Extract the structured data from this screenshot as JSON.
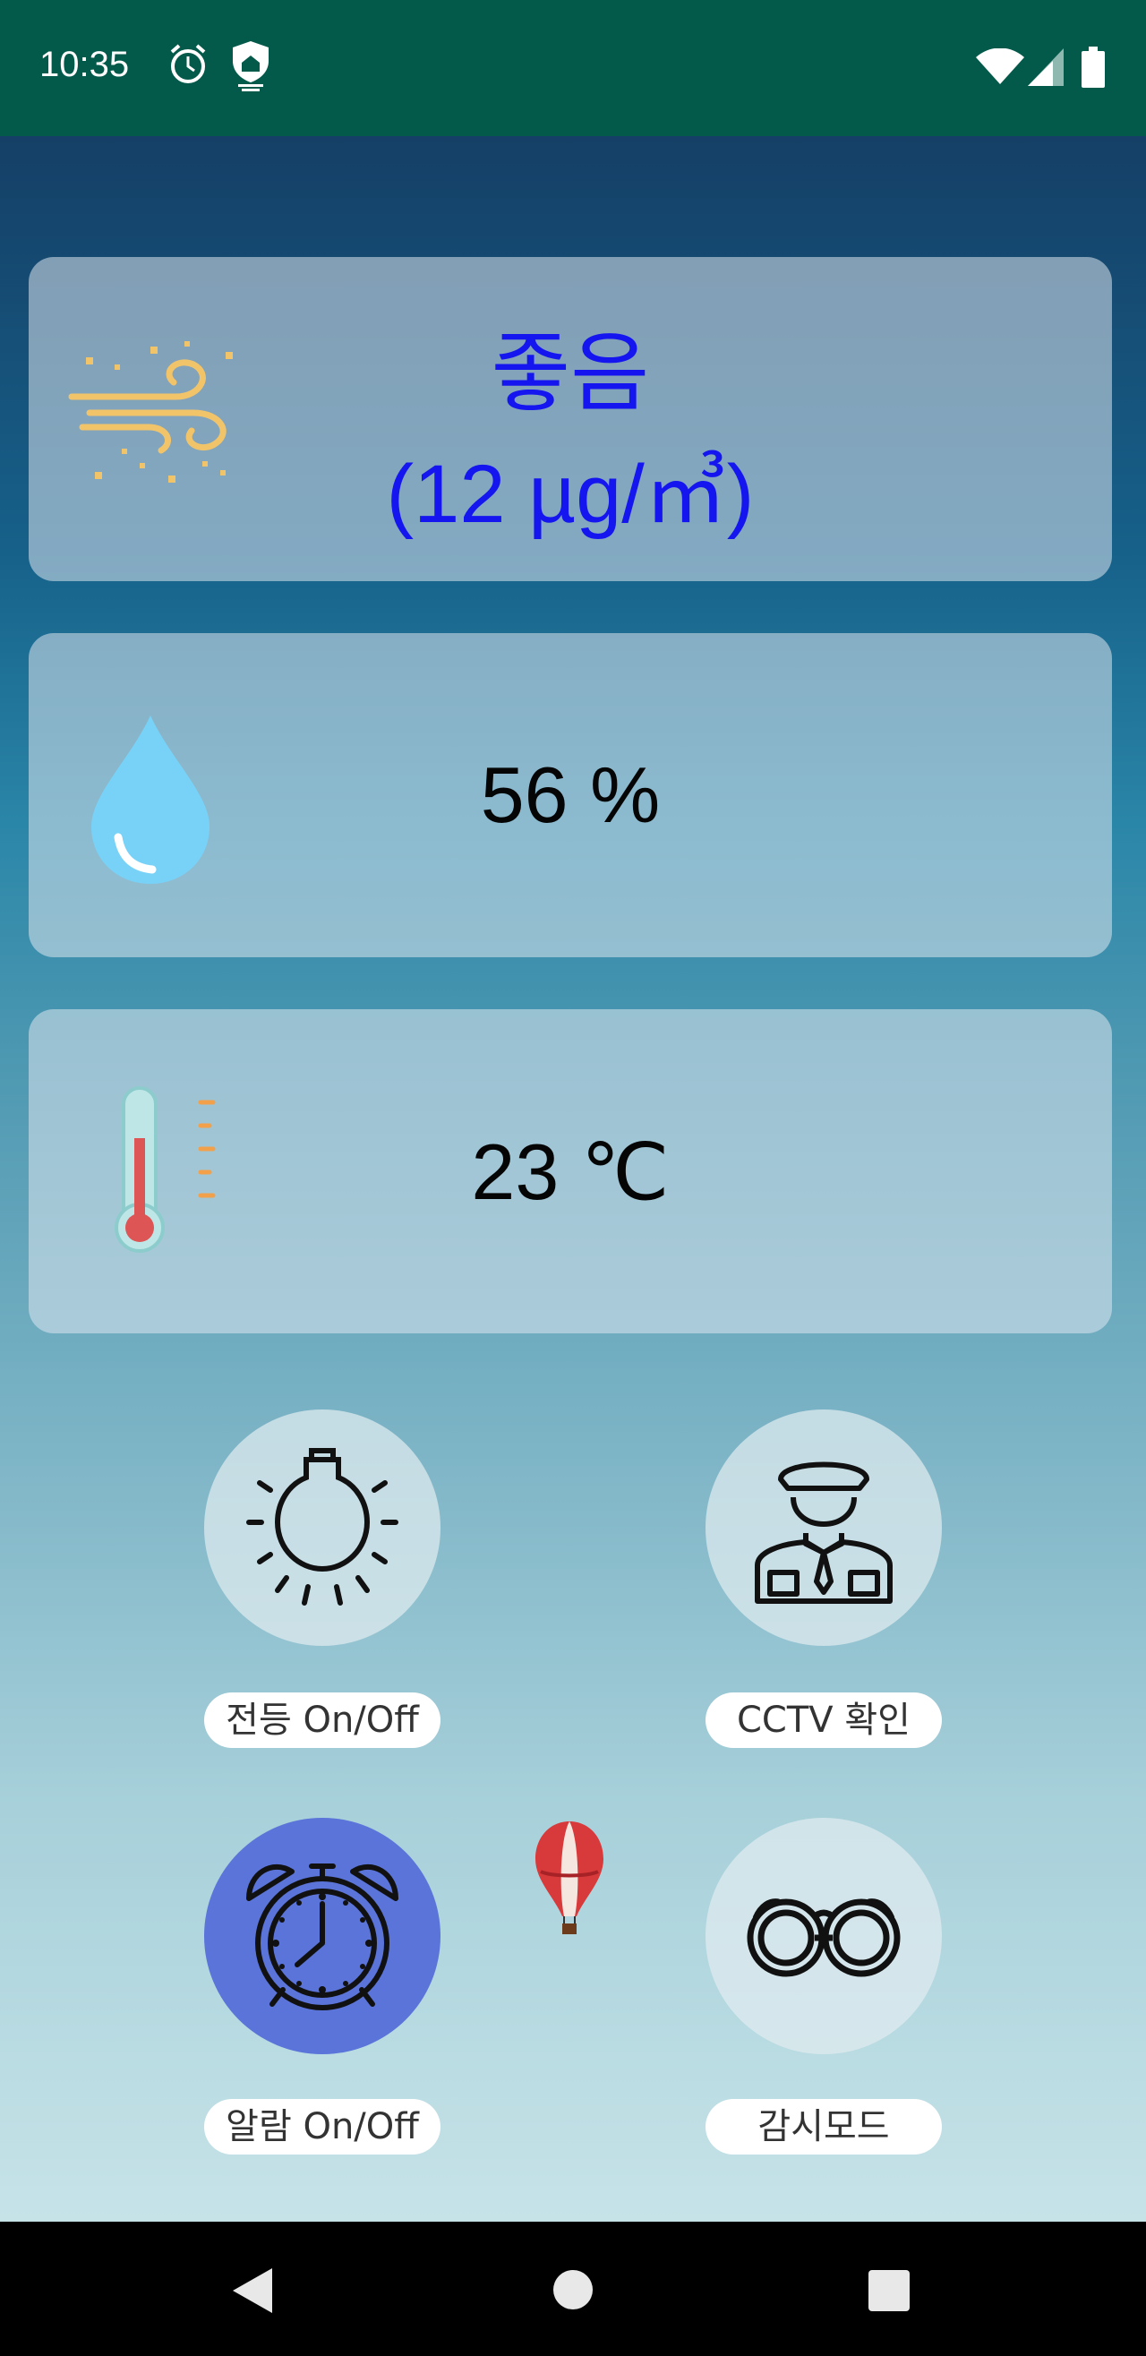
{
  "status_bar": {
    "time": "10:35"
  },
  "air_quality": {
    "status": "좋음",
    "value": "(12 µg/㎥)"
  },
  "humidity": {
    "value": "56 %"
  },
  "temperature": {
    "value": "23 ℃"
  },
  "controls": {
    "light": {
      "label": "전등 On/Off"
    },
    "cctv": {
      "label": "CCTV 확인"
    },
    "alarm": {
      "label": "알람 On/Off"
    },
    "watch": {
      "label": "감시모드"
    }
  },
  "colors": {
    "status_bar": "#03594a",
    "aq_text": "#1515f0",
    "alarm_active": "#5a74d9"
  }
}
